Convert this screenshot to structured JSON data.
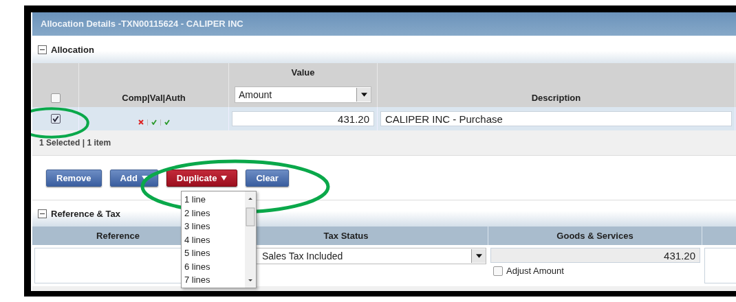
{
  "window": {
    "title": "Allocation Details -TXN00115624 - CALIPER INC"
  },
  "allocation": {
    "title": "Allocation",
    "expanded": true,
    "header": {
      "select_all": {
        "checked": false
      },
      "status_column": "Comp|Val|Auth",
      "value_column": "Value",
      "value_type": "Amount",
      "description_column": "Description"
    },
    "rows": [
      {
        "checked": true,
        "status": [
          {
            "kind": "cross"
          },
          {
            "kind": "check"
          },
          {
            "kind": "check"
          }
        ],
        "value": "431.20",
        "description": "CALIPER INC - Purchase"
      }
    ],
    "footer": "1 Selected | 1 item"
  },
  "buttons": [
    {
      "label": "Remove",
      "has_menu": false,
      "selected": false
    },
    {
      "label": "Add",
      "has_menu": true,
      "selected": false
    },
    {
      "label": "Duplicate",
      "has_menu": true,
      "selected": true
    },
    {
      "label": "Clear",
      "has_menu": false,
      "selected": false
    }
  ],
  "duplicate_menu": {
    "items": [
      "1 line",
      "2 lines",
      "3 lines",
      "4 lines",
      "5 lines",
      "6 lines",
      "7 lines"
    ]
  },
  "reference_tax": {
    "title": "Reference & Tax",
    "expanded": true,
    "columns": [
      "Reference",
      "Tax Status",
      "Goods & Services"
    ],
    "tax_status": "Sales Tax Included",
    "goods_services": "431.20",
    "adjust_amount": {
      "label": "Adjust Amount",
      "checked": false
    }
  }
}
